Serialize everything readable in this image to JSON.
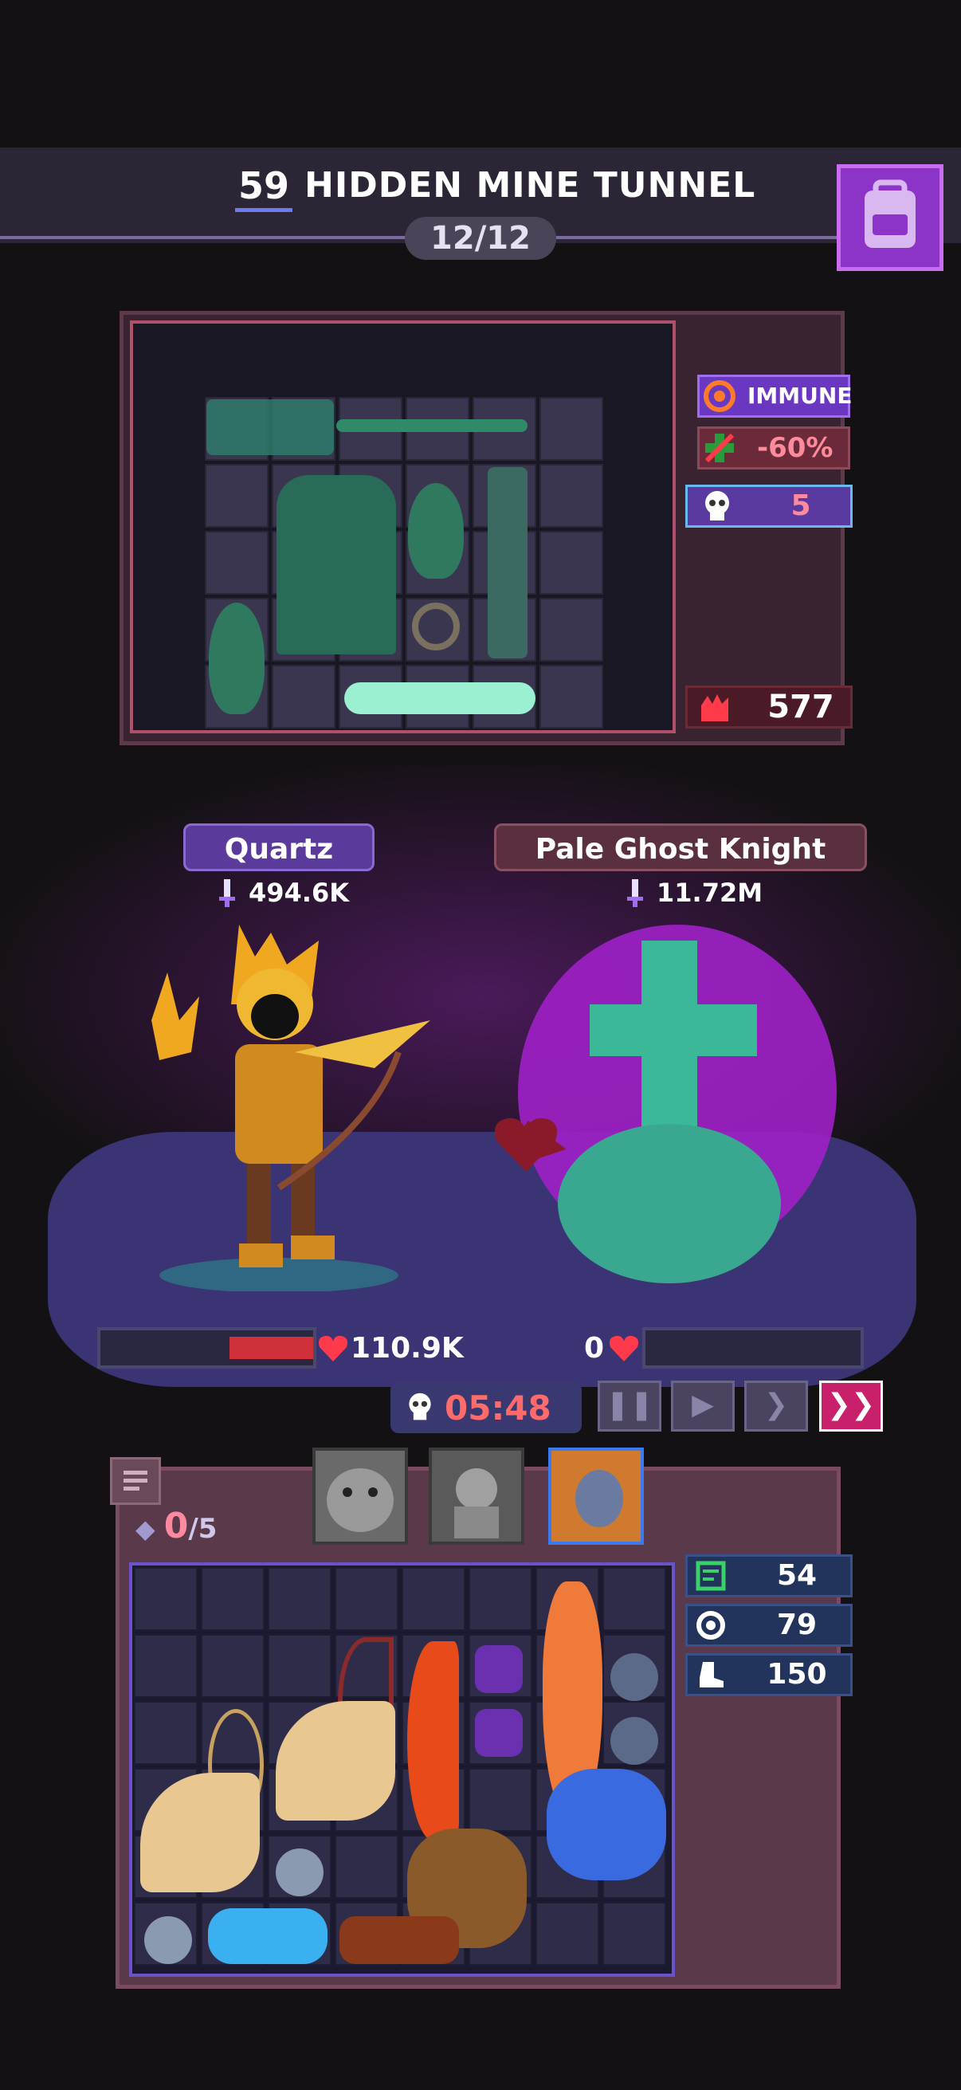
{
  "header": {
    "level": "59",
    "title": "HIDDEN MINE TUNNEL",
    "wave": "12/12"
  },
  "enemy_stats": {
    "immune_label": "IMMUNE",
    "reduction": "-60%",
    "skull_count": "5",
    "rage": "577"
  },
  "player": {
    "name": "Quartz",
    "power": "494.6K",
    "hp": "110.9K"
  },
  "enemy": {
    "name": "Pale Ghost Knight",
    "power": "11.72M",
    "hp": "0"
  },
  "battle": {
    "timer": "05:48",
    "pause_icon": "❚❚",
    "play_icon": "▶",
    "fast_icon": "❯",
    "faster_icon": "❯❯"
  },
  "backpack": {
    "slots_used": "0",
    "slots_total": "/5",
    "stats": [
      {
        "icon": "chart-icon",
        "value": "54"
      },
      {
        "icon": "gear-shield-icon",
        "value": "79"
      },
      {
        "icon": "boot-icon",
        "value": "150"
      }
    ]
  },
  "colors": {
    "accent_purple": "#8c33c8",
    "hp_red": "#ff4a5a",
    "timer_red": "#ff6a6a",
    "blue_stat": "#22345c"
  }
}
